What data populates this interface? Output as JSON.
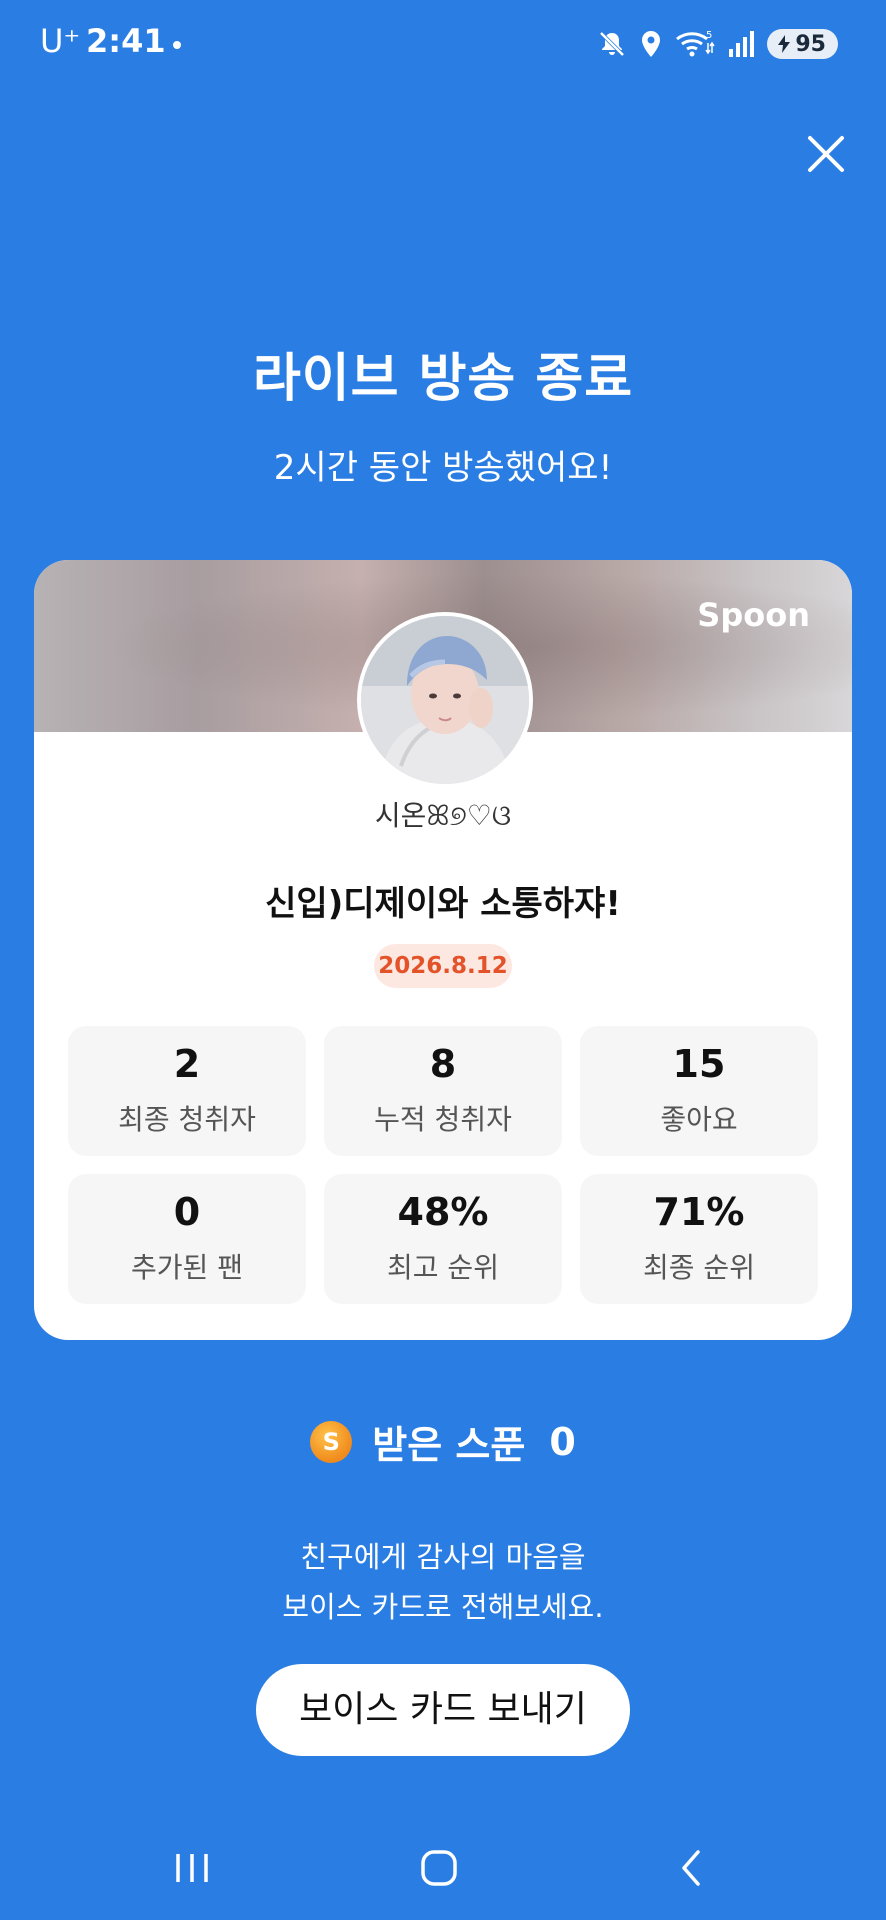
{
  "status_bar": {
    "carrier": "U⁺",
    "time": "2:41",
    "battery": "95",
    "icons": [
      "mute-icon",
      "location-icon",
      "wifi-icon",
      "signal-icon",
      "battery-charging-icon"
    ]
  },
  "header": {
    "title": "라이브 방송 종료",
    "subtitle": "2시간 동안 방송했어요!"
  },
  "card": {
    "brand": "Spoon",
    "username": "시온ꕤ୭♡ଓ",
    "broadcast_title": "신입)디제이와 소통하쟈!",
    "date": "2026.8.12",
    "stats": [
      {
        "value": "2",
        "label": "최종 청취자"
      },
      {
        "value": "8",
        "label": "누적 청취자"
      },
      {
        "value": "15",
        "label": "좋아요"
      },
      {
        "value": "0",
        "label": "추가된 팬"
      },
      {
        "value": "48%",
        "label": "최고 순위"
      },
      {
        "value": "71%",
        "label": "최종 순위"
      }
    ]
  },
  "spoons": {
    "coin_symbol": "S",
    "label": "받은 스푼",
    "count": "0"
  },
  "message": {
    "line1": "친구에게 감사의 마음을",
    "line2": "보이스 카드로 전해보세요."
  },
  "voice_card_button": "보이스 카드 보내기",
  "colors": {
    "background": "#2a7ee3",
    "date_badge_bg": "#fde7e1",
    "date_badge_text": "#e2532a",
    "coin": "#f5a623"
  }
}
